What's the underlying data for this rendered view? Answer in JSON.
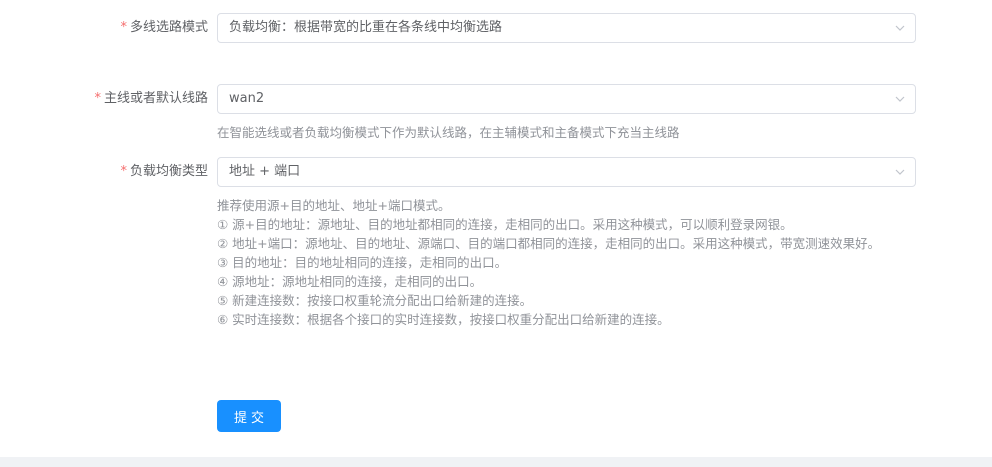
{
  "form": {
    "required_mark": "*",
    "mode": {
      "label": "多线选路模式",
      "value": "负载均衡：根据带宽的比重在各条线中均衡选路"
    },
    "default_line": {
      "label": "主线或者默认线路",
      "value": "wan2",
      "hint": "在智能选线或者负载均衡模式下作为默认线路，在主辅模式和主备模式下充当主线路"
    },
    "balance_type": {
      "label": "负载均衡类型",
      "value": "地址 + 端口",
      "help": [
        "推荐使用源+目的地址、地址+端口模式。",
        "① 源+目的地址：源地址、目的地址都相同的连接，走相同的出口。采用这种模式，可以顺利登录网银。",
        "② 地址+端口：源地址、目的地址、源端口、目的端口都相同的连接，走相同的出口。采用这种模式，带宽测速效果好。",
        "③ 目的地址：目的地址相同的连接，走相同的出口。",
        "④ 源地址：源地址相同的连接，走相同的出口。",
        "⑤ 新建连接数：按接口权重轮流分配出口给新建的连接。",
        "⑥ 实时连接数：根据各个接口的实时连接数，按接口权重分配出口给新建的连接。"
      ]
    },
    "submit_label": "提交"
  },
  "icons": {
    "select_arrow": "chevron-down-icon"
  },
  "colors": {
    "primary": "#1890ff",
    "required": "#f56c6c",
    "border": "#dcdfe6",
    "hint": "#909399"
  }
}
